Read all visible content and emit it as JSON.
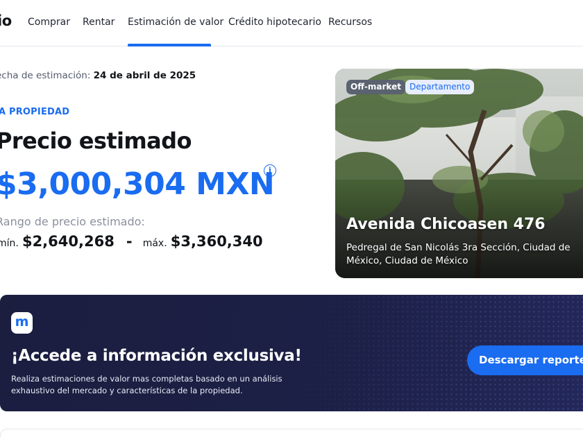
{
  "nav": {
    "brand": "io",
    "items": [
      {
        "label": "Comprar"
      },
      {
        "label": "Rentar"
      },
      {
        "label": "Estimación de valor",
        "active": true
      },
      {
        "label": "Crédito hipotecario"
      },
      {
        "label": "Recursos"
      }
    ]
  },
  "estimate": {
    "date_label": "echa de estimación:",
    "date_value": "24 de abril de 2025",
    "kicker": "A PROPIEDAD",
    "title": "Precio estimado",
    "price": "$3,000,304 MXN",
    "info_icon": "info-circle-icon",
    "range_label": "Rango de precio estimado:",
    "min_label": "mín.",
    "min_value": "$2,640,268",
    "separator": "-",
    "max_label": "máx.",
    "max_value": "$3,360,340"
  },
  "property": {
    "badge_status": "Off-market",
    "badge_type": "Departamento",
    "title": "Avenida Chicoasen 476",
    "address": "Pedregal de San Nicolás 3ra Sección, Ciudad de México, Ciudad de México"
  },
  "promo": {
    "logo_letter": "m",
    "title": "¡Accede a información exclusiva!",
    "description": "Realiza estimaciones de valor mas completas basado en un análisis exhaustivo del mercado y características de la propiedad.",
    "button_label": "Descargar reporte",
    "button_icon": "chevron-down-icon"
  },
  "colors": {
    "accent": "#1a6cf0",
    "banner": "#1c2046",
    "badge_status_bg": "#5b6270"
  }
}
